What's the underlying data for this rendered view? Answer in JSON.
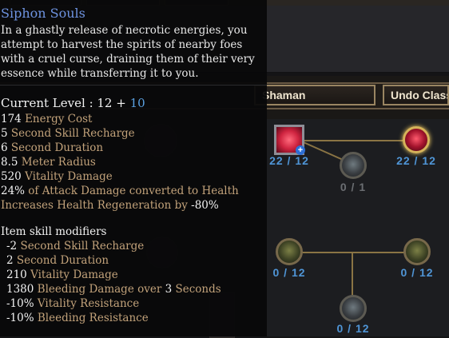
{
  "top_tabs": [
    "",
    "",
    ""
  ],
  "class_buttons": {
    "left_label": "Shaman",
    "right_label": "Undo Class"
  },
  "skill_tree_nodes": [
    {
      "id": "siphon-souls-node",
      "count": "22 / 12"
    },
    {
      "id": "top-right-node",
      "count": "22 / 12"
    },
    {
      "id": "top-mid-node",
      "count": "0 / 1"
    },
    {
      "id": "mid-left-node",
      "count": "0 / 12"
    },
    {
      "id": "mid-right-node",
      "count": "0 / 12"
    },
    {
      "id": "bottom-node",
      "count": "0 / 12"
    }
  ],
  "tooltip": {
    "title": "Siphon Souls",
    "description": "In a ghastly release of necrotic energies, you attempt to harvest the spirits of nearby foes with a cruel curse, draining them of their very essence while transferring it to you.",
    "level_label": "Current Level : ",
    "level_value": "12",
    "level_plus": " + ",
    "level_bonus": "10",
    "stats": [
      {
        "value": "174",
        "label": " Energy Cost"
      },
      {
        "value": "5",
        "label": " Second Skill Recharge"
      },
      {
        "value": "6",
        "label": " Second Duration"
      },
      {
        "value": "8.5",
        "label": " Meter Radius"
      },
      {
        "value": "520",
        "label": " Vitality Damage"
      },
      {
        "value": "24%",
        "label": " of Attack Damage converted to Health"
      },
      {
        "value": "",
        "label": "Increases Health Regeneration by ",
        "suffix": "-80%"
      }
    ],
    "modifiers_title": "Item skill modifiers",
    "modifiers": [
      {
        "value": "-2",
        "label": " Second Skill Recharge"
      },
      {
        "value": "2",
        "label": " Second Duration"
      },
      {
        "value": "210",
        "label": " Vitality Damage"
      },
      {
        "value": "1380",
        "label": " Bleeding Damage over ",
        "value2": "3",
        "label2": " Seconds"
      },
      {
        "value": "-10%",
        "label": " Vitality Resistance"
      },
      {
        "value": "-10%",
        "label": " Bleeding Resistance"
      }
    ]
  }
}
